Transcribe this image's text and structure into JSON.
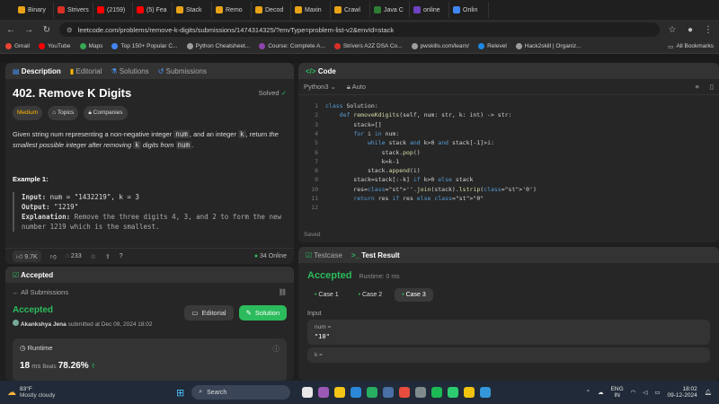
{
  "browser": {
    "tabs": [
      {
        "label": "Binary",
        "color": "#e8a317"
      },
      {
        "label": "Strivers",
        "color": "#d93025"
      },
      {
        "label": "(2159)",
        "color": "#ff0000"
      },
      {
        "label": "(5) Fea",
        "color": "#ff0000"
      },
      {
        "label": "Stack",
        "color": "#e8a317"
      },
      {
        "label": "Remo",
        "color": "#e8a317"
      },
      {
        "label": "Decod",
        "color": "#e8a317"
      },
      {
        "label": "Maxin",
        "color": "#e8a317"
      },
      {
        "label": "Crawl",
        "color": "#e8a317"
      },
      {
        "label": "Java C",
        "color": "#2e7d32"
      },
      {
        "label": "online",
        "color": "#6f42c1"
      },
      {
        "label": "Onlin",
        "color": "#4285f4"
      }
    ],
    "url": "leetcode.com/problems/remove-k-digits/submissions/1474314325/?envType=problem-list-v2&envId=stack",
    "bookmarks": [
      {
        "label": "Gmail",
        "color": "#ea4335"
      },
      {
        "label": "YouTube",
        "color": "#ff0000"
      },
      {
        "label": "Maps",
        "color": "#34a853"
      },
      {
        "label": "Top 150+ Popular C...",
        "color": "#4285f4"
      },
      {
        "label": "Python Cheatsheet...",
        "color": "#9e9e9e"
      },
      {
        "label": "Course: Complete A...",
        "color": "#8e44ad"
      },
      {
        "label": "Strivers A2Z DSA Co...",
        "color": "#d93025"
      },
      {
        "label": "pwskills.com/learn/",
        "color": "#9e9e9e"
      },
      {
        "label": "Relevel",
        "color": "#1e88e5"
      },
      {
        "label": "Hack2skill | Organiz...",
        "color": "#9e9e9e"
      }
    ],
    "all_bookmarks": "All Bookmarks"
  },
  "desc_tabs": {
    "description": "Description",
    "editorial": "Editorial",
    "solutions": "Solutions",
    "submissions": "Submissions"
  },
  "problem": {
    "title": "402. Remove K Digits",
    "status": "Solved",
    "difficulty": "Medium",
    "topics": "Topics",
    "companies": "Companies",
    "text_a": "Given string num representing a non-negative integer ",
    "code_num": "num",
    "text_b": ", and an integer ",
    "code_k": "k",
    "text_c": ", return ",
    "text_d": "the smallest possible integer after removing ",
    "text_e": " digits from ",
    "text_f": ".",
    "example_title": "Example 1:",
    "input_label": "Input:",
    "input_value": " num = \"1432219\", k = 3",
    "output_label": "Output:",
    "output_value": " \"1219\"",
    "explanation_label": "Explanation:",
    "explanation_value": " Remove the three digits 4, 3, and 2 to form the new number 1219 which is the smallest."
  },
  "desc_footer": {
    "likes": "9.7K",
    "comments": "233",
    "online": "34 Online"
  },
  "accepted_panel": {
    "tab": "Accepted",
    "back": "All Submissions",
    "status": "Accepted",
    "user": "Akankshya Jena",
    "submitted": "submitted at Dec 09, 2024 18:02",
    "editorial_btn": "Editorial",
    "solution_btn": "Solution",
    "runtime_label": "Runtime",
    "runtime_value": "18",
    "runtime_unit": "ms",
    "beats_label": "Beats",
    "beats_value": "78.26%"
  },
  "code_panel": {
    "title": "Code",
    "language": "Python3",
    "auto": "Auto",
    "saved": "Saved",
    "lines": [
      "class Solution:",
      "    def removeKdigits(self, num: str, k: int) -> str:",
      "        stack=[]",
      "        for i in num:",
      "            while stack and k>0 and stack[-1]>i:",
      "                stack.pop()",
      "                k=k-1",
      "            stack.append(i)",
      "        stack=stack[:-k] if k>0 else stack",
      "        res=''.join(stack).lstrip('0')",
      "        return res if res else \"0\"",
      ""
    ]
  },
  "test_panel": {
    "tab_testcase": "Testcase",
    "tab_result": "Test Result",
    "status": "Accepted",
    "runtime": "Runtime: 0 ms",
    "cases": [
      "Case 1",
      "Case 2",
      "Case 3"
    ],
    "input_label": "Input",
    "num_label": "num =",
    "num_value": "\"10\"",
    "k_label": "k ="
  },
  "taskbar": {
    "weather_temp": "83°F",
    "weather_desc": "Mostly cloudy",
    "search": "Search",
    "lang_top": "ENG",
    "lang_bottom": "IN",
    "time": "18:02",
    "date": "09-12-2024"
  },
  "colors": {
    "accent_green": "#2cbb5d",
    "medium": "#ffb800",
    "like_blue": "#4c9aff"
  }
}
